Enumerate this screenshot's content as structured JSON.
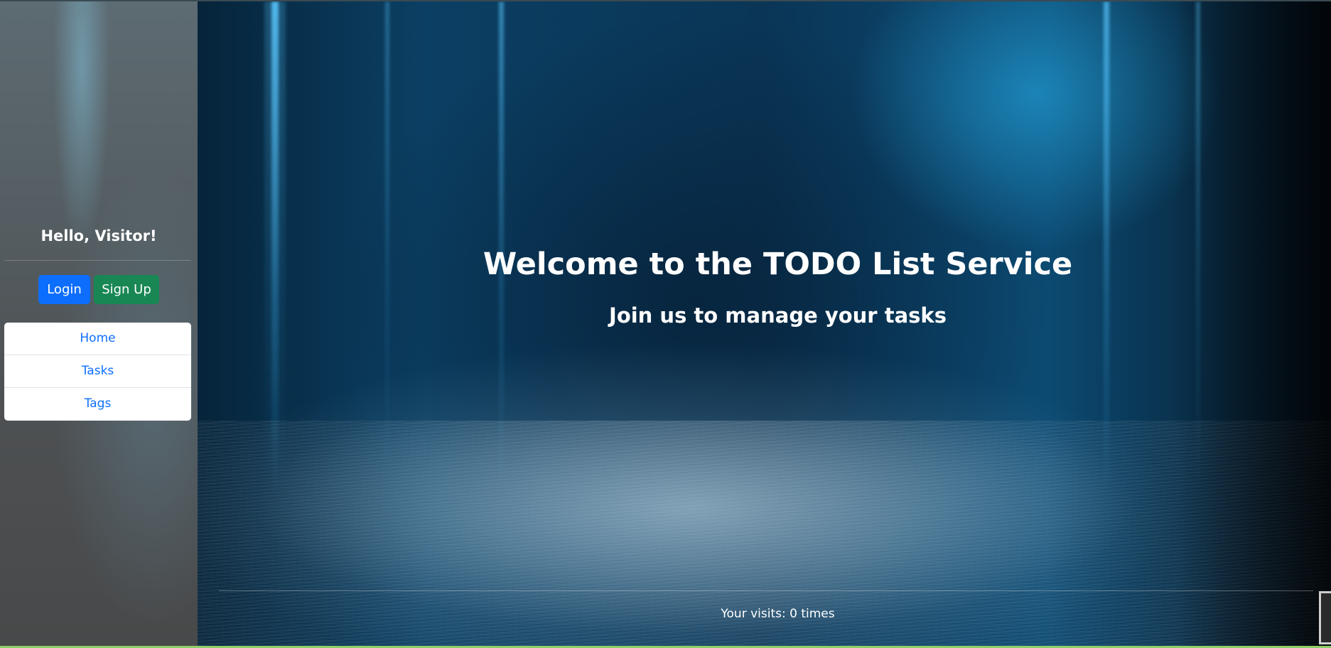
{
  "sidebar": {
    "greeting_prefix": "Hello, ",
    "greeting_name": "Visitor",
    "greeting_suffix": "!",
    "login_label": "Login",
    "signup_label": "Sign Up",
    "nav_items": [
      {
        "label": "Home"
      },
      {
        "label": "Tasks"
      },
      {
        "label": "Tags"
      }
    ]
  },
  "hero": {
    "title": "Welcome to the TODO List Service",
    "subtitle": "Join us to manage your tasks",
    "visits_text": "Your visits: 0 times"
  },
  "colors": {
    "login_button": "#0d6efd",
    "signup_button": "#198754",
    "nav_link": "#0d6efd"
  }
}
